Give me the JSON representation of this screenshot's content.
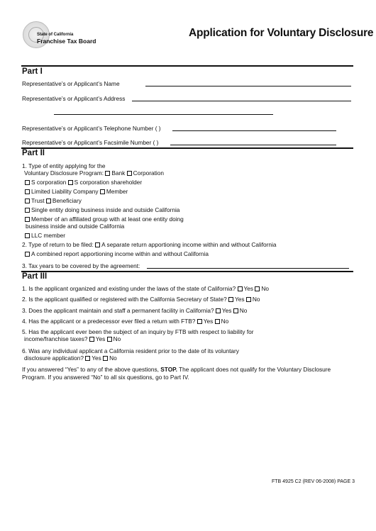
{
  "header": {
    "agency_small": "State of California",
    "agency_name": "Franchise Tax Board",
    "title": "Application for Voluntary Disclosure"
  },
  "part1": {
    "heading": "Part I",
    "name_label": "Representative’s or Applicant’s Name",
    "address_label": "Representative’s or Applicant’s Address",
    "phone_label": "Representative’s or Applicant’s Telephone Number  (    )",
    "fax_label": "Representative’s or Applicant’s Facsimile Number  (    )"
  },
  "part2": {
    "heading": "Part II",
    "q1_line1": "1. Type of entity applying for the",
    "q1_line2": "Voluntary Disclosure Program:",
    "opt_bank": "Bank",
    "opt_corporation": "Corporation",
    "opt_s_corp": "S corporation",
    "opt_s_corp_shareholder": "S corporation shareholder",
    "opt_llc": "Limited Liability Company",
    "opt_member": "Member",
    "opt_trust": "Trust",
    "opt_beneficiary": "Beneficiary",
    "opt_single_entity": "Single entity doing business inside and outside California",
    "opt_affiliated_line1": "Member of an affiliated group with at least one entity doing",
    "opt_affiliated_line2": "business inside and outside California",
    "opt_llc_member": "LLC member",
    "q2_label": "2. Type of return to be filed:",
    "opt_separate_return": "A separate return apportioning income within and without California",
    "opt_combined_report": "A combined report apportioning income within and without California",
    "q3_label": "3. Tax years to be covered by the agreement:"
  },
  "part3": {
    "heading": "Part III",
    "yes": "Yes",
    "no": "No",
    "q1": "1. Is the applicant organized and existing under the laws of the state of California?",
    "q2": "2. Is the applicant qualified or registered with the California Secretary of State?",
    "q3": "3. Does the applicant maintain and staff a permanent facility in California?",
    "q4": "4. Has the applicant or a predecessor ever filed a return with FTB?",
    "q5_line1": "5. Has the applicant ever been the subject of an inquiry by FTB with respect to liability for",
    "q5_line2": "income/franchise taxes?",
    "q6_line1": "6. Was any individual applicant a California resident prior to the date of its voluntary",
    "q6_line2": "disclosure application?",
    "instr_a": "If you answered “Yes” to any of the above questions,",
    "instr_stop": "STOP.",
    "instr_b": "The applicant does not qualify for the Voluntary Disclosure",
    "instr_line2": "Program. If you answered “No” to all six questions, go to Part IV."
  },
  "footer": {
    "form_id": "FTB 4925 C2 (REV 06-2008) PAGE 3"
  }
}
